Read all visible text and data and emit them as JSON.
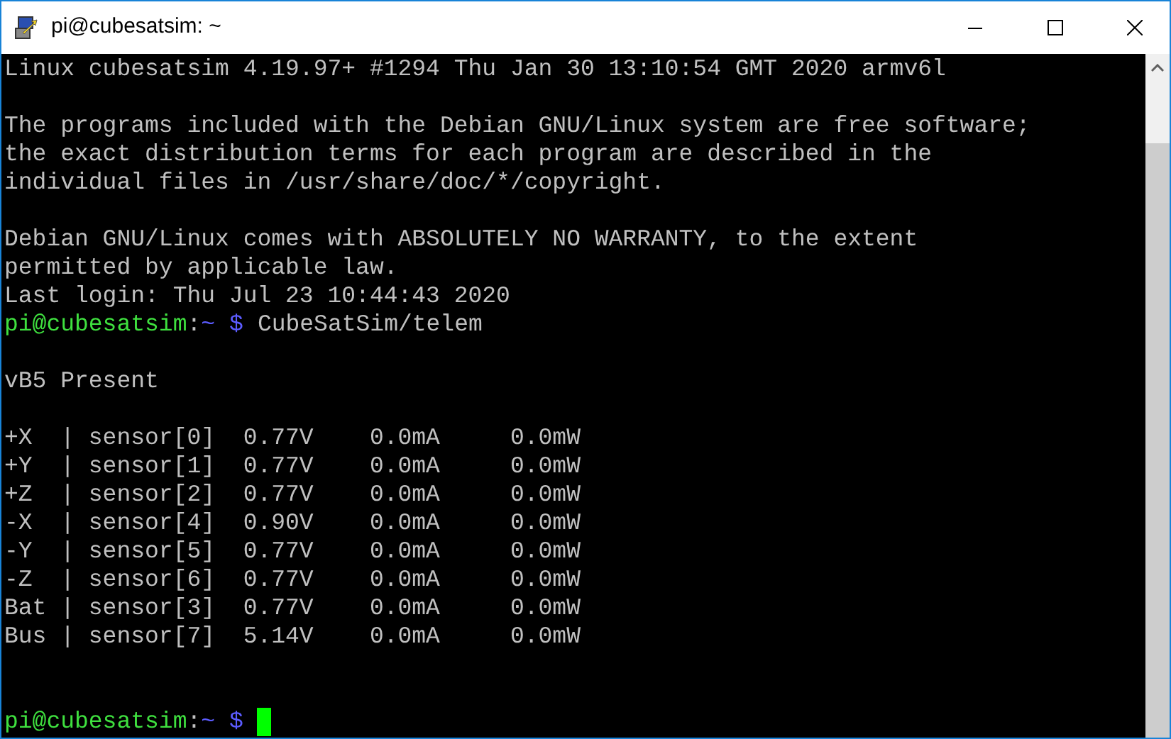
{
  "window": {
    "title": "pi@cubesatsim: ~"
  },
  "terminal": {
    "lines": [
      {
        "kind": "text",
        "text": "Linux cubesatsim 4.19.97+ #1294 Thu Jan 30 13:10:54 GMT 2020 armv6l"
      },
      {
        "kind": "blank"
      },
      {
        "kind": "text",
        "text": "The programs included with the Debian GNU/Linux system are free software;"
      },
      {
        "kind": "text",
        "text": "the exact distribution terms for each program are described in the"
      },
      {
        "kind": "text",
        "text": "individual files in /usr/share/doc/*/copyright."
      },
      {
        "kind": "blank"
      },
      {
        "kind": "text",
        "text": "Debian GNU/Linux comes with ABSOLUTELY NO WARRANTY, to the extent"
      },
      {
        "kind": "text",
        "text": "permitted by applicable law."
      },
      {
        "kind": "text",
        "text": "Last login: Thu Jul 23 10:44:43 2020"
      },
      {
        "kind": "prompt",
        "user": "pi@cubesatsim",
        "sep": ":",
        "dir": "~",
        "sign": "$",
        "command": "CubeSatSim/telem"
      },
      {
        "kind": "blank"
      },
      {
        "kind": "text",
        "text": "vB5 Present"
      },
      {
        "kind": "blank"
      },
      {
        "kind": "text",
        "text": "+X  | sensor[0]  0.77V    0.0mA     0.0mW"
      },
      {
        "kind": "text",
        "text": "+Y  | sensor[1]  0.77V    0.0mA     0.0mW"
      },
      {
        "kind": "text",
        "text": "+Z  | sensor[2]  0.77V    0.0mA     0.0mW"
      },
      {
        "kind": "text",
        "text": "-X  | sensor[4]  0.90V    0.0mA     0.0mW"
      },
      {
        "kind": "text",
        "text": "-Y  | sensor[5]  0.77V    0.0mA     0.0mW"
      },
      {
        "kind": "text",
        "text": "-Z  | sensor[6]  0.77V    0.0mA     0.0mW"
      },
      {
        "kind": "text",
        "text": "Bat | sensor[3]  0.77V    0.0mA     0.0mW"
      },
      {
        "kind": "text",
        "text": "Bus | sensor[7]  5.14V    0.0mA     0.0mW"
      },
      {
        "kind": "blank"
      },
      {
        "kind": "blank"
      },
      {
        "kind": "prompt",
        "user": "pi@cubesatsim",
        "sep": ":",
        "dir": "~",
        "sign": "$",
        "cursor": true
      }
    ]
  }
}
